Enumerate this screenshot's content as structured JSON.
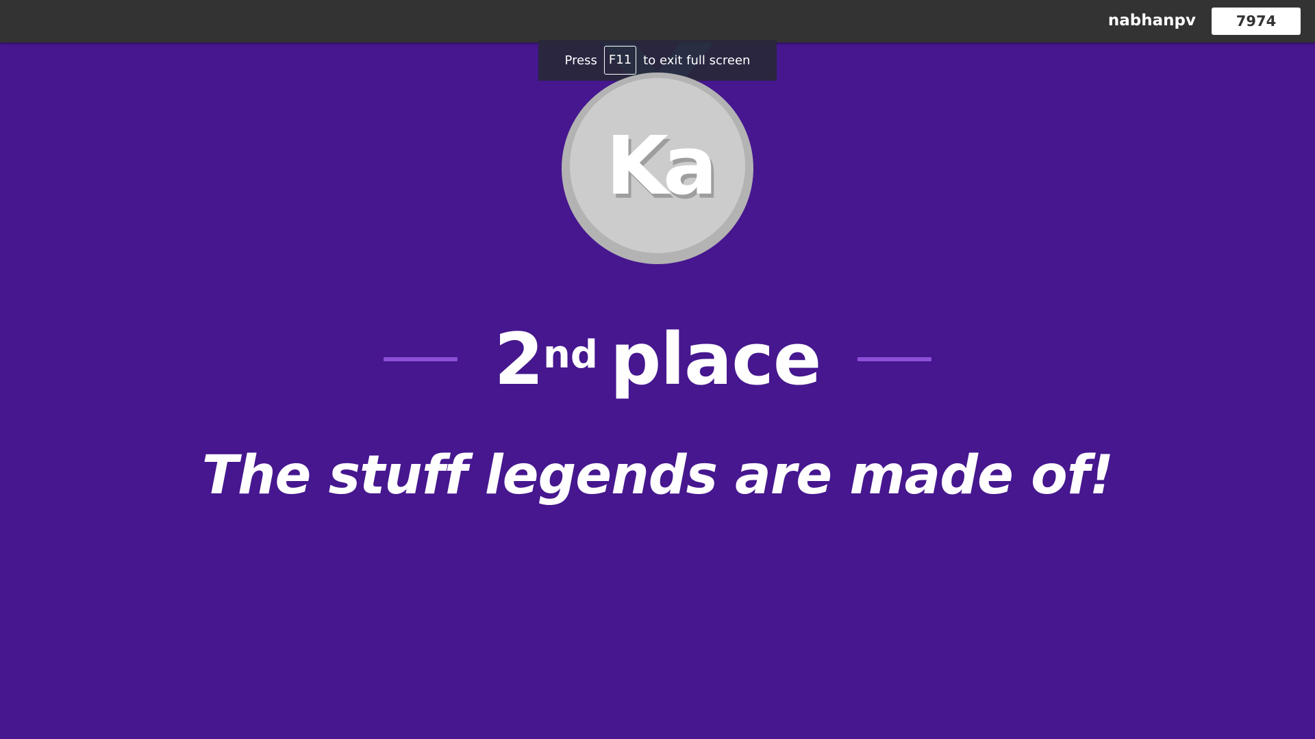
{
  "topbar": {
    "player_name": "nabhanpv",
    "score": "7974"
  },
  "fullscreen_notice": {
    "prefix": "Press",
    "key": "F11",
    "suffix": "to exit full screen"
  },
  "medal": {
    "logo_text": "Ka",
    "icon": "silver-medal-icon",
    "color": "#cccccc"
  },
  "result": {
    "rank_number": "2",
    "rank_suffix": "nd",
    "rank_word": "place",
    "tagline": "The stuff legends are made of!"
  },
  "colors": {
    "background": "#46178f",
    "topbar": "#333333",
    "divider": "#8c4fd8",
    "medal_rim": "#b3b3b3",
    "medal_face": "#cccccc",
    "ribbon": "#2a7fb8"
  }
}
